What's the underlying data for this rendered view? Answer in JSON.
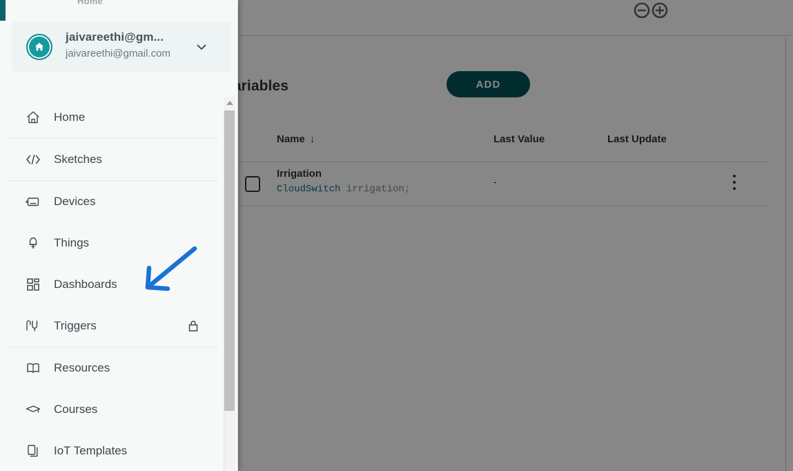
{
  "window": {
    "clipped_title": "Home",
    "logo_name": "arduino-infinity-logo"
  },
  "account": {
    "display_name": "jaivareethi@gm...",
    "email": "jaivareethi@gmail.com",
    "avatar_icon": "home-icon",
    "expand_icon": "chevron-down-icon",
    "avatar_color": "#149ba2",
    "avatar_ring_color": "#0e8c93"
  },
  "sidebar": {
    "items": [
      {
        "label": "Home",
        "icon": "home-icon",
        "locked": false,
        "divider_after": true
      },
      {
        "label": "Sketches",
        "icon": "code-icon",
        "locked": false,
        "divider_after": true
      },
      {
        "label": "Devices",
        "icon": "device-chip-icon",
        "locked": false,
        "divider_after": false
      },
      {
        "label": "Things",
        "icon": "thing-bulb-icon",
        "locked": false,
        "divider_after": false
      },
      {
        "label": "Dashboards",
        "icon": "grid-icon",
        "locked": false,
        "divider_after": false
      },
      {
        "label": "Triggers",
        "icon": "trigger-plug-icon",
        "locked": true,
        "divider_after": true
      },
      {
        "label": "Resources",
        "icon": "book-icon",
        "locked": false,
        "divider_after": false
      },
      {
        "label": "Courses",
        "icon": "graduation-cap-icon",
        "locked": false,
        "divider_after": false
      },
      {
        "label": "IoT Templates",
        "icon": "copy-docs-icon",
        "locked": false,
        "divider_after": false
      }
    ],
    "lock_icon": "lock-icon",
    "scrollbar_up_icon": "scroll-up-arrow-icon"
  },
  "main": {
    "section_title": "Cloud Variables",
    "add_label": "ADD",
    "add_color": "#00535a",
    "table": {
      "columns": [
        "Name",
        "Last Value",
        "Last Update"
      ],
      "sort_column": "Name",
      "sort_icon": "arrow-down-icon",
      "rows": [
        {
          "name": "Irrigation",
          "declaration_type": "CloudSwitch",
          "declaration_rest": " irrigation;",
          "last_value": "-",
          "last_update": "",
          "menu_icon": "kebab-menu-icon"
        }
      ]
    }
  },
  "annotation": {
    "arrow_icon": "pointer-arrow-icon",
    "arrow_color": "#1a73d4",
    "points_at": "Dashboards"
  }
}
